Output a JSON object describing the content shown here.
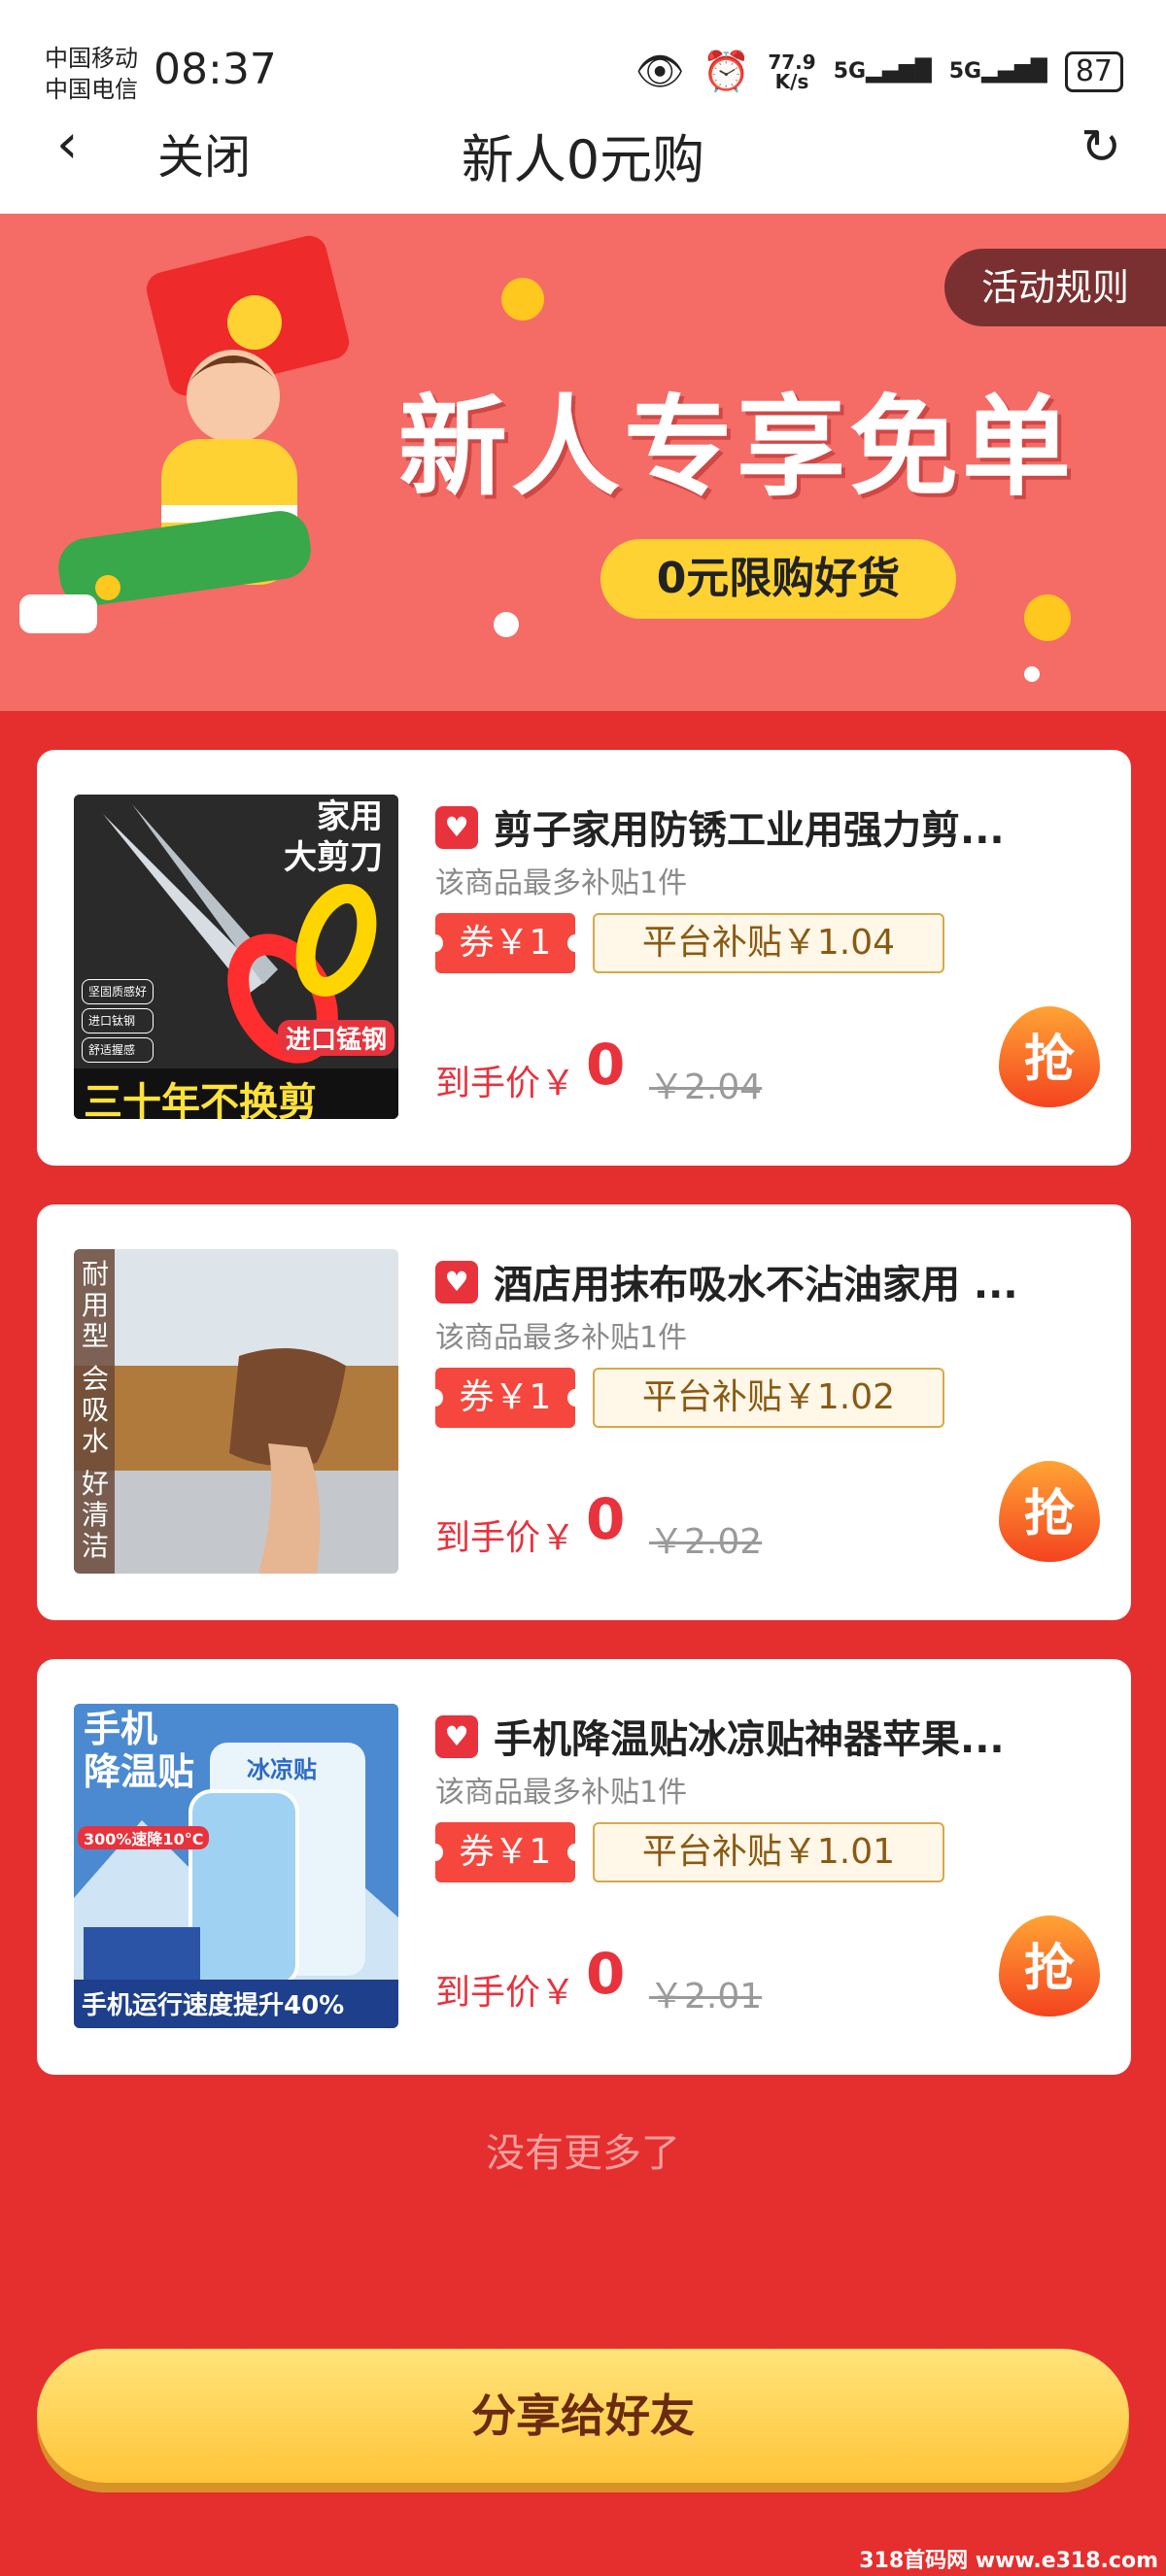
{
  "status_bar": {
    "carrier1": "中国移动",
    "carrier2": "中国电信",
    "time": "08:37",
    "net_speed": "77.9",
    "net_speed_unit": "K/s",
    "sig1": "5G",
    "sig2": "5G",
    "battery": "87"
  },
  "nav": {
    "back_icon": "chevron-left-icon",
    "close_label": "关闭",
    "title": "新人0元购",
    "refresh_icon": "refresh-icon"
  },
  "banner": {
    "rules_label": "活动规则",
    "headline": "新人专享免单",
    "subline": "0元限购好货"
  },
  "products": [
    {
      "name": "剪子家用防锈工业用强力剪...",
      "limit": "该商品最多补贴1件",
      "coupon": "券￥1",
      "subsidy": "平台补贴￥1.04",
      "final_label": "到手价￥",
      "final_value": "0",
      "original": "￥2.04",
      "grab": "抢",
      "thumb_text": [
        "家用",
        "大剪刀",
        "进口锰钢",
        "三十年不换剪",
        "坚固质感好",
        "进口钛钢",
        "舒适握感"
      ]
    },
    {
      "name": "酒店用抹布吸水不沾油家用 ...",
      "limit": "该商品最多补贴1件",
      "coupon": "券￥1",
      "subsidy": "平台补贴￥1.02",
      "final_label": "到手价￥",
      "final_value": "0",
      "original": "￥2.02",
      "grab": "抢",
      "thumb_text": [
        "耐用型",
        "会吸水",
        "好清洁"
      ]
    },
    {
      "name": "手机降温贴冰凉贴神器苹果...",
      "limit": "该商品最多补贴1件",
      "coupon": "券￥1",
      "subsidy": "平台补贴￥1.01",
      "final_label": "到手价￥",
      "final_value": "0",
      "original": "￥2.01",
      "grab": "抢",
      "thumb_text": [
        "手机",
        "降温贴",
        "300%速降10°C",
        "冰凉贴",
        "手机运行速度提升40%"
      ]
    }
  ],
  "footer": {
    "no_more": "没有更多了",
    "share_label": "分享给好友",
    "watermark": "318首码网 www.e318.com"
  },
  "colors": {
    "page_bg": "#e52e2e",
    "banner_bg": "#f56b66",
    "accent_red": "#e8323c",
    "gold": "#ffd233"
  }
}
